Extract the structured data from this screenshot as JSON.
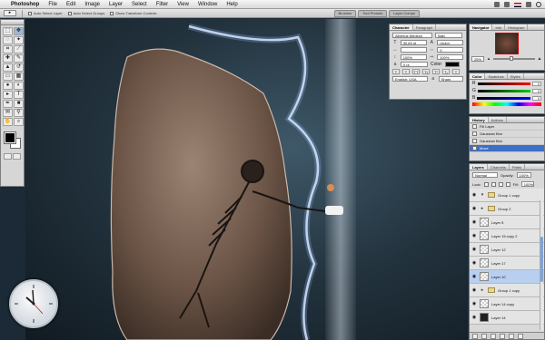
{
  "menubar": {
    "app_name": "Photoshop",
    "items": [
      "File",
      "Edit",
      "Image",
      "Layer",
      "Select",
      "Filter",
      "View",
      "Window",
      "Help"
    ]
  },
  "options_bar": {
    "checks": [
      "Auto Select Layer",
      "Auto Select Groups",
      "Show Transform Controls"
    ],
    "well_tabs": [
      "Brushes",
      "Tool Presets",
      "Layer Comps"
    ]
  },
  "character": {
    "tabs": [
      "Character",
      "Paragraph"
    ],
    "font": "Albertus Medium",
    "style": "Italic",
    "size": "30.69 pt",
    "leading": "(Auto)",
    "kerning": "",
    "tracking": "0",
    "scale_v": "100%",
    "scale_h": "100%",
    "baseline": "0 pt",
    "color_label": "Color:",
    "language": "English: USA",
    "antialias": "Sharp"
  },
  "navigator": {
    "tabs": [
      "Navigator",
      "Info",
      "Histogram"
    ],
    "zoom": "25%"
  },
  "color": {
    "tabs": [
      "Color",
      "Swatches",
      "Styles"
    ],
    "channels": [
      {
        "label": "R",
        "value": "0"
      },
      {
        "label": "G",
        "value": "0"
      },
      {
        "label": "B",
        "value": "0"
      }
    ]
  },
  "history": {
    "tabs": [
      "History",
      "Actions"
    ],
    "items": [
      "Fill Layer",
      "Gaussian Blur",
      "Gaussian Blur",
      "Move"
    ]
  },
  "layers": {
    "tabs": [
      "Layers",
      "Channels",
      "Paths"
    ],
    "blend_mode": "Normal",
    "opacity_label": "Opacity:",
    "opacity": "100%",
    "lock_label": "Lock:",
    "fill_label": "Fill:",
    "fill": "100%",
    "rows": [
      {
        "name": "Group 1 copy",
        "thumb": "folder"
      },
      {
        "name": "Group 2",
        "thumb": "folder"
      },
      {
        "name": "Layer 5",
        "thumb": "trans"
      },
      {
        "name": "Layer 15 copy 2",
        "thumb": "trans"
      },
      {
        "name": "Layer 12",
        "thumb": "trans"
      },
      {
        "name": "Layer 17",
        "thumb": "trans"
      },
      {
        "name": "Layer 10",
        "thumb": "trans"
      },
      {
        "name": "Group 1 copy",
        "thumb": "folder"
      },
      {
        "name": "Layer 14 copy",
        "thumb": "trans"
      },
      {
        "name": "Layer 14",
        "thumb": "dark"
      }
    ]
  }
}
